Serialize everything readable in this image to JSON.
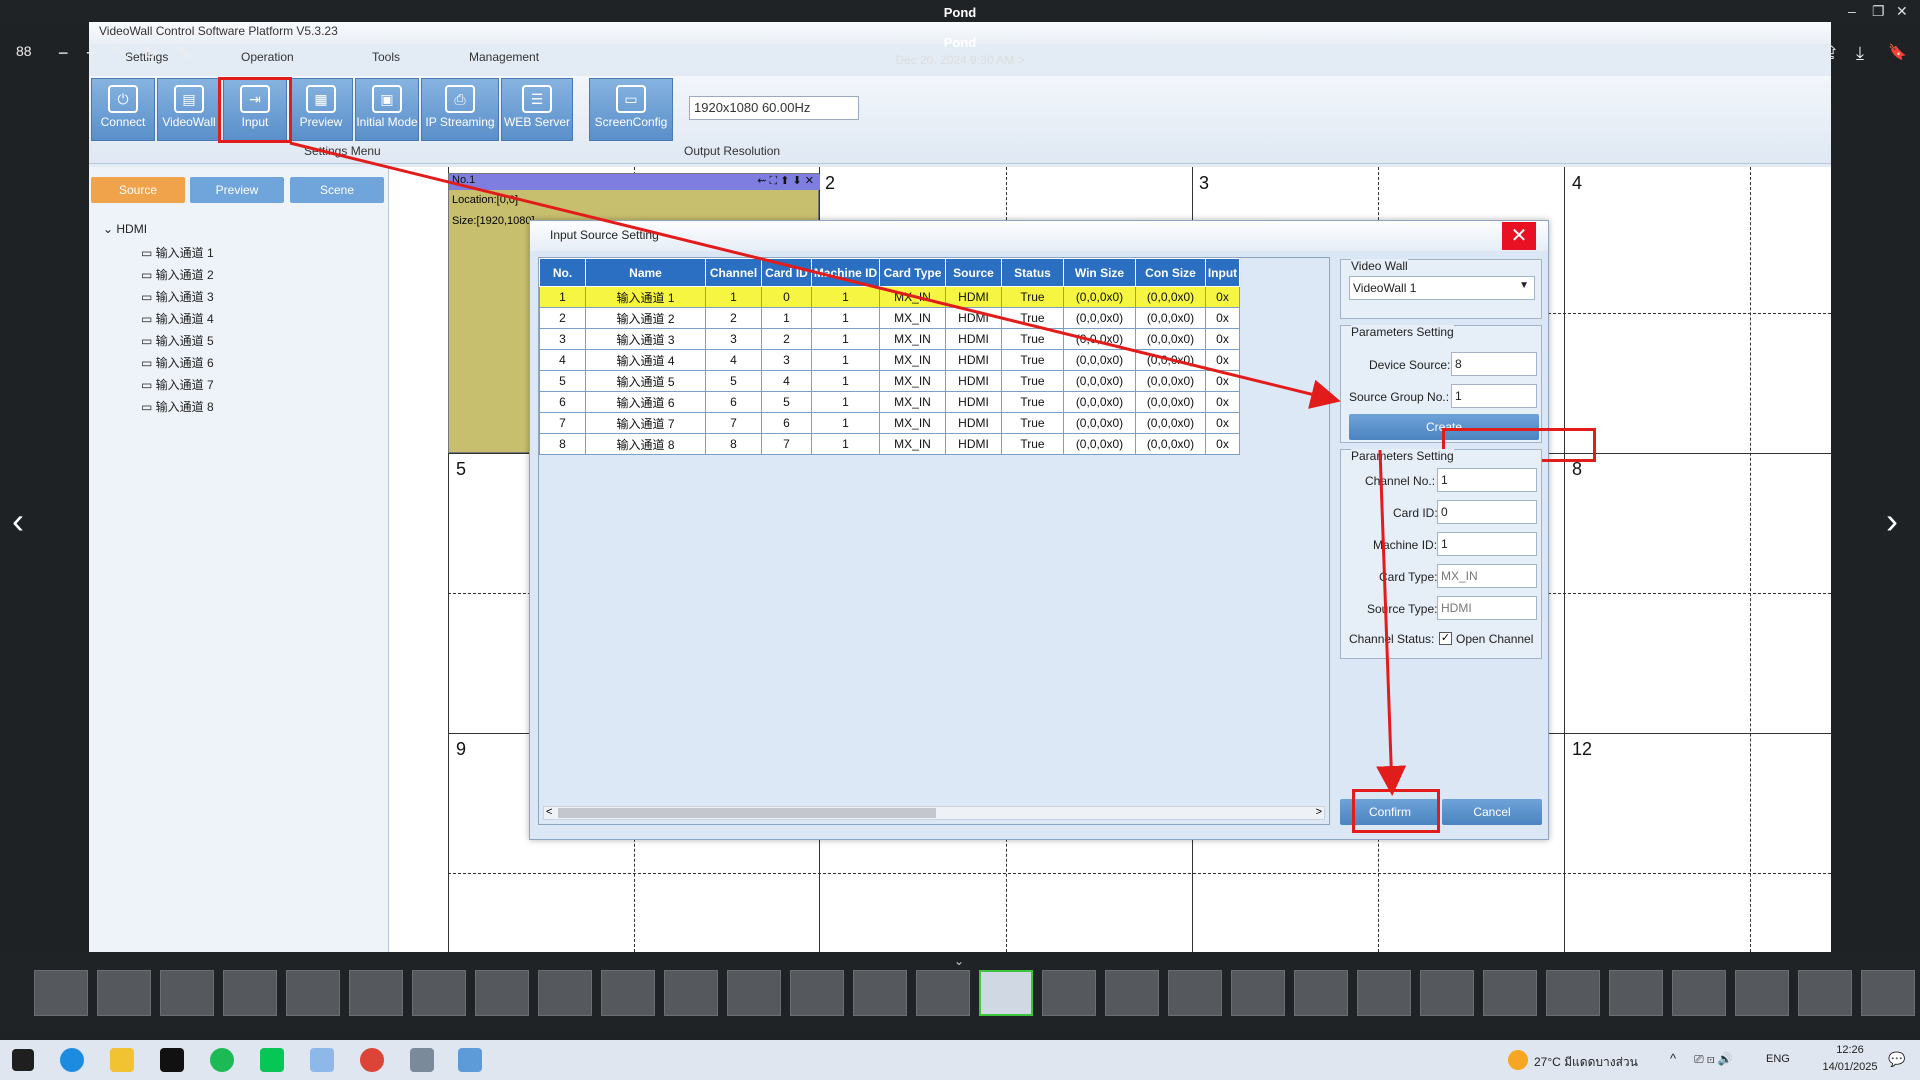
{
  "viewer": {
    "window_title": "Pond",
    "photo_title": "Pond",
    "photo_date": "Dec 20, 2024 9:30 AM",
    "date_chevron": ">",
    "win_min": "–",
    "win_restore": "❐",
    "win_close": "✕",
    "grid_icon": "88",
    "zoom_out": "−",
    "zoom_in": "+",
    "crop_icon": "⤡",
    "rotate_icon": "↻",
    "edit_icon": "✎",
    "share_icon": "⇪",
    "download_icon": "⤓",
    "bookmark_icon": "🔖",
    "prev_arrow": "‹",
    "next_arrow": "›",
    "filmstrip_chevron": "⌄"
  },
  "app": {
    "title": "VideoWall Control Software Platform V5.3.23",
    "menu": [
      "Settings",
      "Operation",
      "Tools",
      "Management"
    ],
    "ribbon_buttons": [
      "Connect",
      "VideoWall",
      "Input",
      "Preview",
      "Initial Mode",
      "IP Streaming",
      "WEB Server",
      "ScreenConfig"
    ],
    "ribbon_icons": [
      "⏻",
      "▤",
      "⇥",
      "▦",
      "▣",
      "⎙",
      "☰",
      "▭"
    ],
    "settings_menu_label": "Settings Menu",
    "output_resolution_label": "Output Resolution",
    "resolution_value": "1920x1080 60.00Hz"
  },
  "left_panel": {
    "tabs": [
      "Source",
      "Preview",
      "Scene"
    ],
    "tree_root": "HDMI",
    "tree_items": [
      "输入通道 1",
      "输入通道 2",
      "输入通道 3",
      "输入通道 4",
      "输入通道 5",
      "输入通道 6",
      "输入通道 7",
      "输入通道 8"
    ]
  },
  "canvas": {
    "cell_numbers": [
      "2",
      "3",
      "4",
      "5",
      "8",
      "9",
      "12"
    ],
    "window1": {
      "header": "No.1",
      "location": "Location:[0,0]",
      "size": "Size:[1920,1080]",
      "header_icons": "⇜ ⛶ ⬆ ⬇ ✕"
    }
  },
  "dialog": {
    "title": "Input Source Setting",
    "close": "✕",
    "columns": [
      "No.",
      "Name",
      "Channel",
      "Card ID",
      "Machine ID",
      "Card Type",
      "Source",
      "Status",
      "Win Size",
      "Con Size",
      "Input"
    ],
    "rows": [
      [
        "1",
        "输入通道 1",
        "1",
        "0",
        "1",
        "MX_IN",
        "HDMI",
        "True",
        "(0,0,0x0)",
        "(0,0,0x0)",
        "0x"
      ],
      [
        "2",
        "输入通道 2",
        "2",
        "1",
        "1",
        "MX_IN",
        "HDMI",
        "True",
        "(0,0,0x0)",
        "(0,0,0x0)",
        "0x"
      ],
      [
        "3",
        "输入通道 3",
        "3",
        "2",
        "1",
        "MX_IN",
        "HDMI",
        "True",
        "(0,0,0x0)",
        "(0,0,0x0)",
        "0x"
      ],
      [
        "4",
        "输入通道 4",
        "4",
        "3",
        "1",
        "MX_IN",
        "HDMI",
        "True",
        "(0,0,0x0)",
        "(0,0,0x0)",
        "0x"
      ],
      [
        "5",
        "输入通道 5",
        "5",
        "4",
        "1",
        "MX_IN",
        "HDMI",
        "True",
        "(0,0,0x0)",
        "(0,0,0x0)",
        "0x"
      ],
      [
        "6",
        "输入通道 6",
        "6",
        "5",
        "1",
        "MX_IN",
        "HDMI",
        "True",
        "(0,0,0x0)",
        "(0,0,0x0)",
        "0x"
      ],
      [
        "7",
        "输入通道 7",
        "7",
        "6",
        "1",
        "MX_IN",
        "HDMI",
        "True",
        "(0,0,0x0)",
        "(0,0,0x0)",
        "0x"
      ],
      [
        "8",
        "输入通道 8",
        "8",
        "7",
        "1",
        "MX_IN",
        "HDMI",
        "True",
        "(0,0,0x0)",
        "(0,0,0x0)",
        "0x"
      ]
    ],
    "scroll_left": "<",
    "scroll_right": ">",
    "video_wall_label": "Video Wall",
    "video_wall_value": "VideoWall 1",
    "params1_label": "Parameters Setting",
    "device_source_label": "Device Source:",
    "device_source_value": "8",
    "source_group_label": "Source Group No.:",
    "source_group_value": "1",
    "create_label": "Create",
    "params2_label": "Parameters Setting",
    "channel_no_label": "Channel No.:",
    "channel_no_value": "1",
    "card_id_label": "Card ID:",
    "card_id_value": "0",
    "machine_id_label": "Machine ID:",
    "machine_id_value": "1",
    "card_type_label": "Card Type:",
    "card_type_value": "MX_IN",
    "source_type_label": "Source Type:",
    "source_type_value": "HDMI",
    "channel_status_label": "Channel Status:",
    "open_channel_label": "Open Channel",
    "check_mark": "✓",
    "confirm_label": "Confirm",
    "cancel_label": "Cancel"
  },
  "taskbar": {
    "weather": "27°C มีแดดบางส่วน",
    "lang": "ENG",
    "time": "12:26",
    "date": "14/01/2025",
    "tray_chevron": "^",
    "tray_icons": "⎚ ⊡ 🔊",
    "notification": "💬"
  },
  "colors": {
    "annotation_red": "#e21b1b",
    "table_header": "#2a6fc1",
    "selected_row": "#f5f542"
  }
}
